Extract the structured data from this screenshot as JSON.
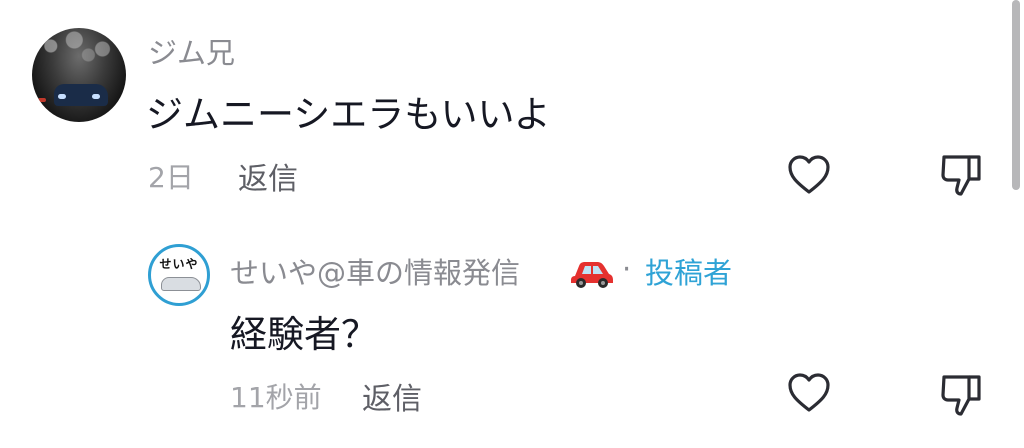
{
  "comments": [
    {
      "username": "ジム兄",
      "text": "ジムニーシエラもいいよ",
      "time": "2日",
      "reply_label": "返信",
      "icons": {
        "like": "heart-outline-icon",
        "dislike": "thumbs-down-outline-icon"
      }
    }
  ],
  "replies": [
    {
      "username": "せいや@車の情報発信",
      "username_emoji": "red-car-emoji",
      "separator": "·",
      "creator_badge": "投稿者",
      "avatar_text": "せいや",
      "text": "経験者？",
      "time": "11秒前",
      "reply_label": "返信",
      "icons": {
        "like": "heart-outline-icon",
        "dislike": "thumbs-down-outline-icon"
      }
    }
  ],
  "colors": {
    "username": "#8a8b91",
    "creator_badge": "#2fa3d6",
    "text": "#161823",
    "timestamp": "#a3a4a9",
    "action": "#5e5f66",
    "icon": "#2b2c33",
    "avatar_ring": "#2f9fd3"
  }
}
